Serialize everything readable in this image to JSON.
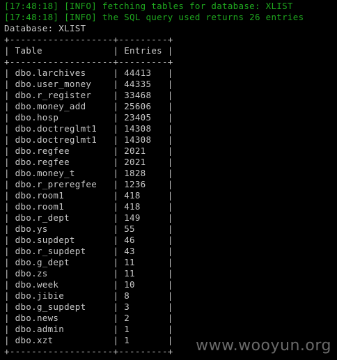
{
  "log_lines": [
    "[17:48:18] [INFO] fetching tables for database: XLIST",
    "[17:48:18] [INFO] the SQL query used returns 26 entries"
  ],
  "database_line": "Database: XLIST",
  "table": {
    "border": "+-------------------+---------+",
    "header": [
      "Table",
      "Entries"
    ],
    "rows": [
      [
        "dbo.larchives",
        "44413"
      ],
      [
        "dbo.user_money",
        "44335"
      ],
      [
        "dbo.r_register",
        "33468"
      ],
      [
        "dbo.money_add",
        "25606"
      ],
      [
        "dbo.hosp",
        "23405"
      ],
      [
        "dbo.doctreglmt1",
        "14308"
      ],
      [
        "dbo.doctreglmt1",
        "14308"
      ],
      [
        "dbo.regfee",
        "2021"
      ],
      [
        "dbo.regfee",
        "2021"
      ],
      [
        "dbo.money_t",
        "1828"
      ],
      [
        "dbo.r_preregfee",
        "1236"
      ],
      [
        "dbo.room1",
        "418"
      ],
      [
        "dbo.room1",
        "418"
      ],
      [
        "dbo.r_dept",
        "149"
      ],
      [
        "dbo.ys",
        "55"
      ],
      [
        "dbo.supdept",
        "46"
      ],
      [
        "dbo.r_supdept",
        "43"
      ],
      [
        "dbo.g_dept",
        "11"
      ],
      [
        "dbo.zs",
        "11"
      ],
      [
        "dbo.week",
        "10"
      ],
      [
        "dbo.jibie",
        "8"
      ],
      [
        "dbo.g_supdept",
        "3"
      ],
      [
        "dbo.news",
        "2"
      ],
      [
        "dbo.admin",
        "1"
      ],
      [
        "dbo.xzt",
        "1"
      ]
    ]
  },
  "watermark": "www.wooyun.org",
  "colors": {
    "background": "#000000",
    "log_text": "#1fa81f",
    "output_text": "#c8c8c8",
    "watermark": "#6a6a6a"
  }
}
